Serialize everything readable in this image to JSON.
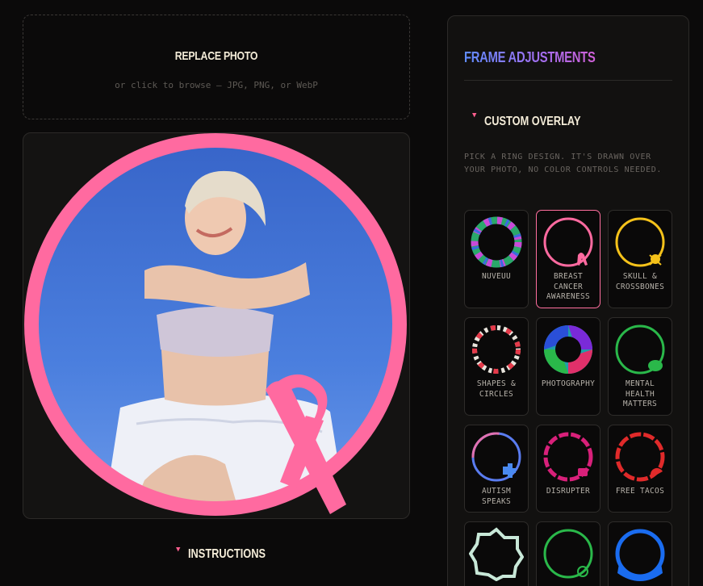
{
  "upload": {
    "title": "REPLACE PHOTO",
    "hint": "or click to browse — JPG, PNG, or WebP"
  },
  "preview": {
    "frame_color": "#ff6aa0",
    "overlay_icon": "pink-ribbon-icon"
  },
  "instructions": {
    "label": "INSTRUCTIONS"
  },
  "panel": {
    "title": "FRAME ADJUSTMENTS",
    "section": {
      "label": "CUSTOM OVERLAY",
      "description": "PICK A RING DESIGN. IT'S DRAWN OVER YOUR PHOTO, NO COLOR CONTROLS NEEDED."
    },
    "overlays": [
      {
        "label": "NUVEUU",
        "icon": "mosaic-ring-icon",
        "selected": false
      },
      {
        "label": "BREAST CANCER AWARENESS",
        "icon": "pink-ribbon-ring-icon",
        "selected": true
      },
      {
        "label": "SKULL & CROSSBONES",
        "icon": "skull-ring-icon",
        "selected": false
      },
      {
        "label": "SHAPES & CIRCLES",
        "icon": "shapes-ring-icon",
        "selected": false
      },
      {
        "label": "PHOTOGRAPHY",
        "icon": "aperture-ring-icon",
        "selected": false
      },
      {
        "label": "MENTAL HEALTH MATTERS",
        "icon": "brain-ring-icon",
        "selected": false
      },
      {
        "label": "AUTISM SPEAKS",
        "icon": "puzzle-ring-icon",
        "selected": false
      },
      {
        "label": "DISRUPTER",
        "icon": "disrupter-ring-icon",
        "selected": false
      },
      {
        "label": "FREE TACOS",
        "icon": "taco-ring-icon",
        "selected": false
      },
      {
        "label": "",
        "icon": "star-ring-icon",
        "selected": false
      },
      {
        "label": "",
        "icon": "money-ring-icon",
        "selected": false
      },
      {
        "label": "",
        "icon": "wave-ring-icon",
        "selected": false
      }
    ]
  }
}
